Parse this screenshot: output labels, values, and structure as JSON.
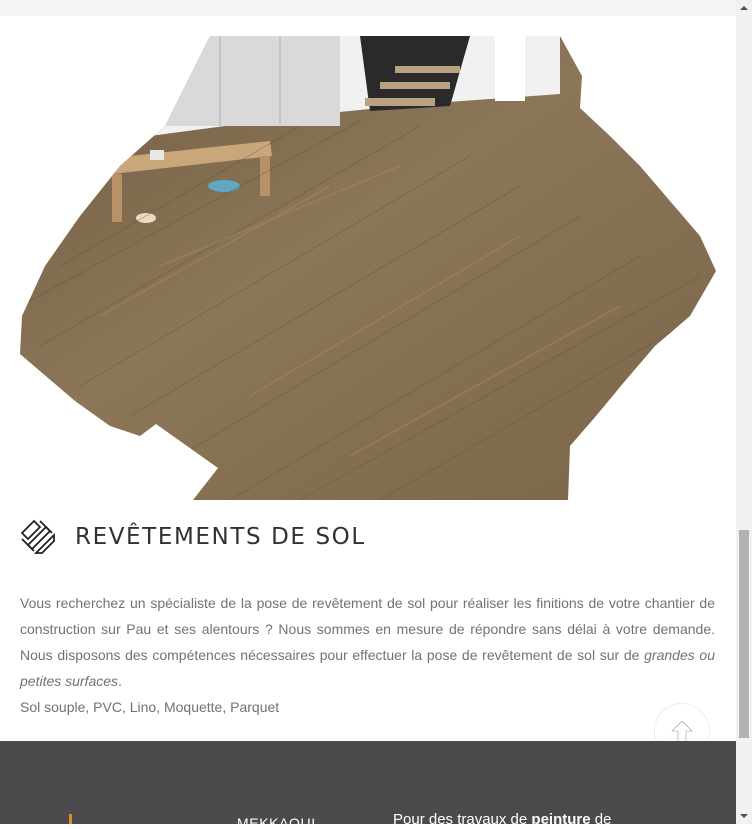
{
  "section": {
    "heading": "REVÊTEMENTS DE SOL",
    "icon": "parquet-pattern-icon",
    "description_part1": "Vous recherchez un spécialiste de la pose de revêtement de sol pour réaliser les finitions de votre chantier de construction sur Pau et ses alentours ? Nous sommes en mesure de répondre sans délai à votre demande. Nous disposons des compétences nécessaires pour effectuer la pose de revêtement de sol sur de ",
    "description_emphasis": "grandes ou petites surfaces",
    "description_end": ".",
    "tags": "Sol souple, PVC, Lino, Moquette, Parquet"
  },
  "scroll_top": {
    "icon": "arrow-up-icon"
  },
  "footer": {
    "company_name": "MEKKAOUI",
    "text_before": "Pour des travaux de ",
    "text_bold": "peinture",
    "text_after": " de"
  },
  "colors": {
    "footer_bg": "#4b4b4d",
    "heading": "#2f3133",
    "body_text": "#6f7377",
    "floor_wood": "#8a7357"
  }
}
